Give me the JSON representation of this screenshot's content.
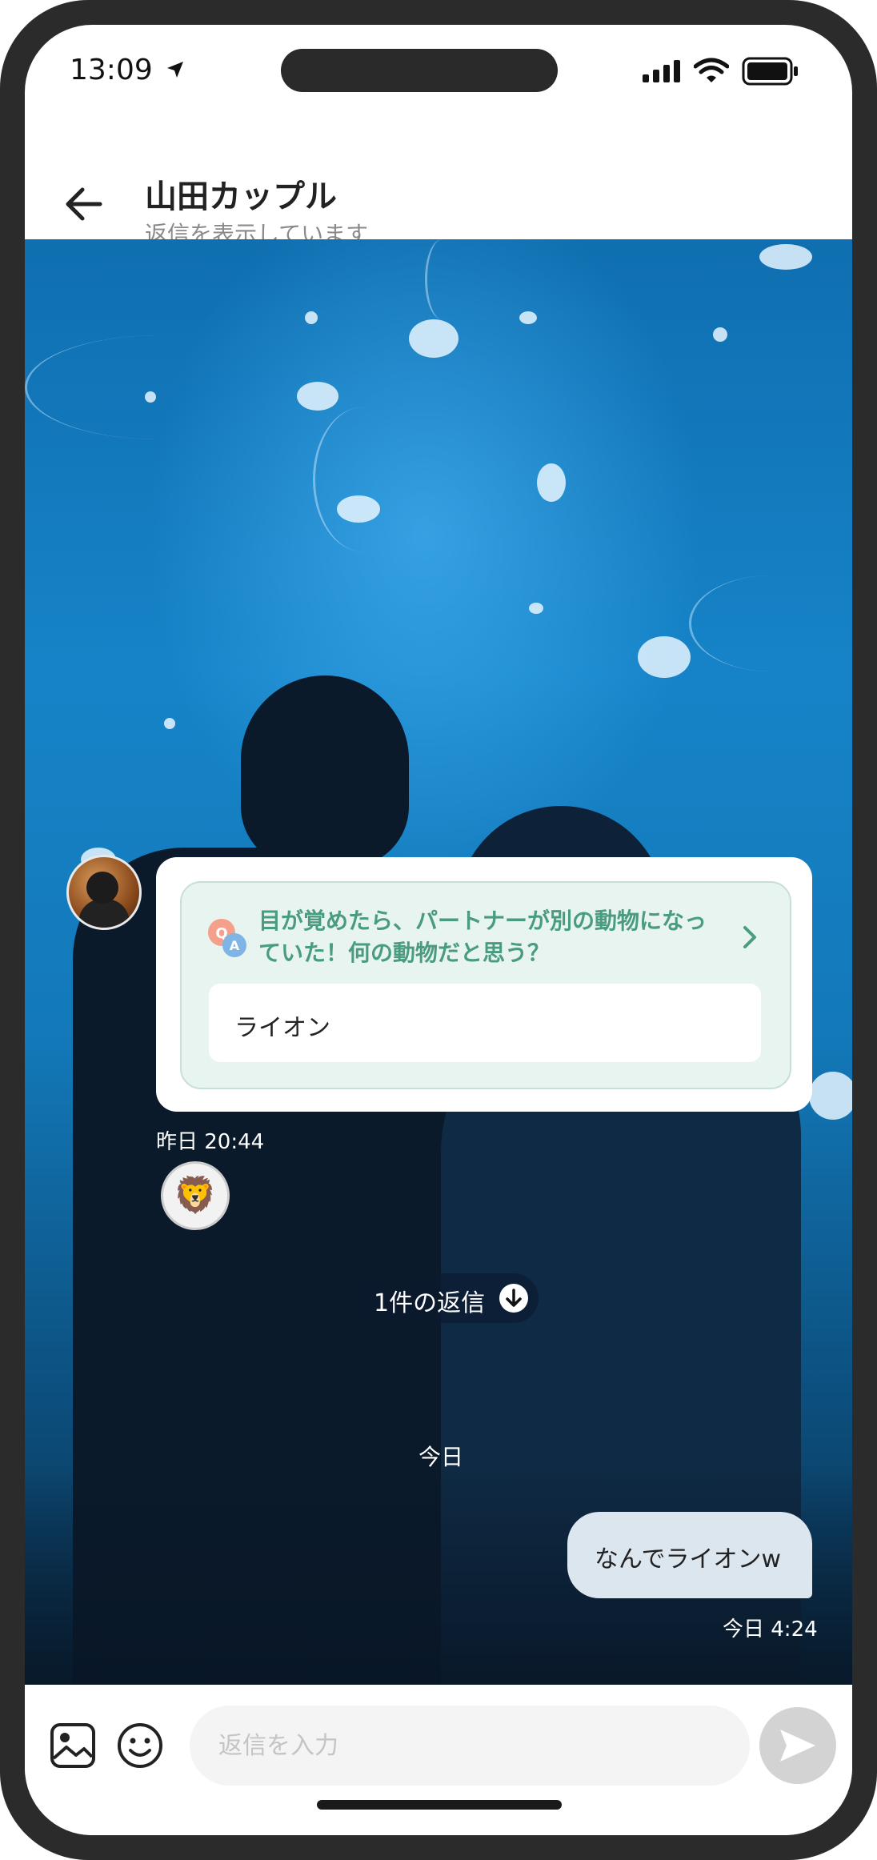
{
  "status_bar": {
    "time": "13:09",
    "icons": [
      "location-arrow-icon",
      "signal-icon",
      "wifi-icon",
      "battery-icon"
    ]
  },
  "header": {
    "back_icon": "arrow-left-icon",
    "title": "山田カップル",
    "subtitle": "返信を表示しています"
  },
  "post": {
    "question": "目が覚めたら、パートナーが別の動物になっていた！何の動物だと思う？",
    "answer": "ライオン",
    "timestamp": "昨日 20:44",
    "reaction_emoji": "🦁",
    "replies_label": "1件の返信"
  },
  "thread": {
    "day_divider": "今日",
    "messages": [
      {
        "text": "なんでライオンw",
        "time": "今日 4:24",
        "from": "me"
      }
    ]
  },
  "composer": {
    "placeholder": "返信を入力",
    "value": ""
  },
  "colors": {
    "accent_green": "#4a9c80",
    "bubble_me": "#dce6ef",
    "send_disabled": "#d3d3d3"
  }
}
